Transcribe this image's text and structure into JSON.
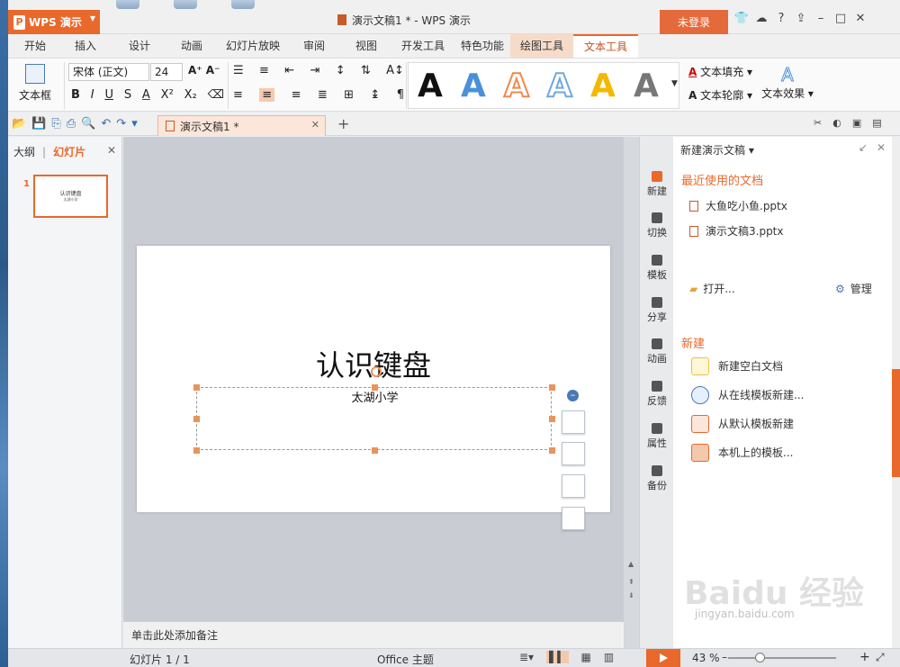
{
  "app": {
    "logo_label": "WPS 演示",
    "doc_title": "演示文稿1 * - WPS 演示",
    "login_label": "未登录"
  },
  "menu": {
    "tabs": [
      "开始",
      "插入",
      "设计",
      "动画",
      "幻灯片放映",
      "审阅",
      "视图",
      "开发工具",
      "特色功能",
      "绘图工具",
      "文本工具"
    ]
  },
  "ribbon": {
    "textbox_label": "文本框",
    "font_name": "宋体 (正文)",
    "font_size": "24",
    "style_letter": "A",
    "text_fill": "文本填充",
    "text_outline": "文本轮廓",
    "text_effect": "文本效果"
  },
  "doc_tab": {
    "label": "演示文稿1 *"
  },
  "left_panel": {
    "tab_outline": "大纲",
    "tab_slides": "幻灯片",
    "slide_number": "1",
    "thumb_title": "认识键盘",
    "thumb_subtitle": "太湖小学"
  },
  "slide": {
    "title": "认识键盘",
    "subtitle": "太湖小学"
  },
  "notes": {
    "placeholder": "单击此处添加备注"
  },
  "right_strip": {
    "items": [
      "新建",
      "切换",
      "模板",
      "分享",
      "动画",
      "反馈",
      "属性",
      "备份"
    ]
  },
  "task_pane": {
    "header": "新建演示文稿",
    "recent_heading": "最近使用的文档",
    "recent_files": [
      "大鱼吃小鱼.pptx",
      "演示文稿3.pptx"
    ],
    "open_label": "打开...",
    "manage_label": "管理",
    "new_heading": "新建",
    "new_items": [
      "新建空白文档",
      "从在线模板新建...",
      "从默认模板新建",
      "本机上的模板..."
    ]
  },
  "status": {
    "slide_info": "幻灯片 1 / 1",
    "theme": "Office 主题",
    "zoom": "43 %"
  },
  "watermark": {
    "brand": "Baidu 经验",
    "url": "jingyan.baidu.com"
  },
  "colors": {
    "accent": "#e9682b",
    "style_colors": [
      "#111111",
      "#4a90d9",
      "#f08a4b",
      "#6fa8dc",
      "#f5b800",
      "#777777"
    ]
  }
}
